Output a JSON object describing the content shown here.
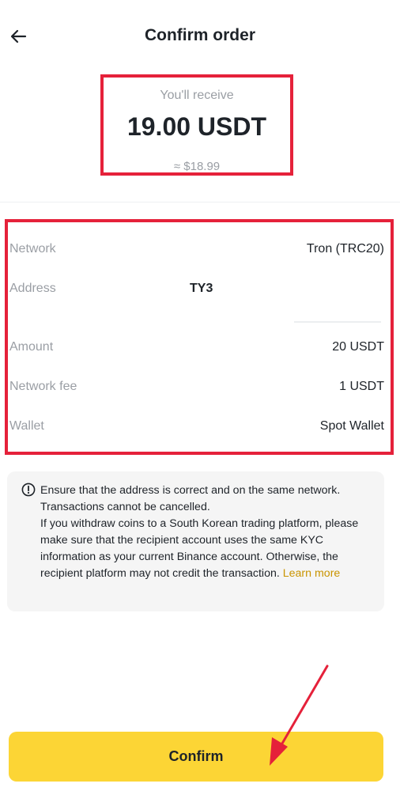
{
  "header": {
    "title": "Confirm order",
    "back_icon": "arrow-left-icon"
  },
  "receive": {
    "label": "You'll receive",
    "amount": "19.00 USDT",
    "approx": "≈ $18.99"
  },
  "details": {
    "network": {
      "label": "Network",
      "value": "Tron (TRC20)"
    },
    "address": {
      "label": "Address",
      "value": "TY3"
    },
    "amount": {
      "label": "Amount",
      "value": "20 USDT"
    },
    "fee": {
      "label": "Network fee",
      "value": "1 USDT"
    },
    "wallet": {
      "label": "Wallet",
      "value": "Spot Wallet"
    }
  },
  "notice": {
    "icon": "info-circle-icon",
    "line1": "Ensure that the address is correct and on the same network. Transactions cannot be cancelled.",
    "line2": "If you withdraw coins to a South Korean trading platform, please make sure that the recipient account uses the same KYC information as your current Binance account. Otherwise, the recipient platform may not credit the transaction.",
    "learn_more": "Learn more"
  },
  "footer": {
    "confirm_label": "Confirm"
  },
  "colors": {
    "accent": "#fcd535",
    "highlight_border": "#e5213a",
    "link": "#c99400",
    "muted_text": "#9a9ea4"
  }
}
